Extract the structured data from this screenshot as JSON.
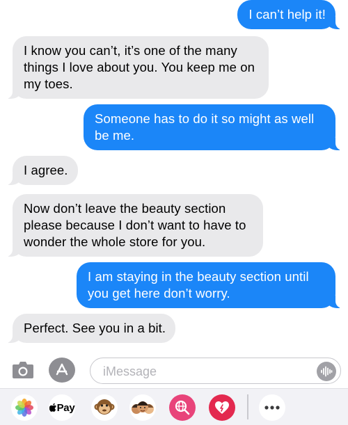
{
  "messages": [
    {
      "from": "me",
      "text": "I can’t help it!"
    },
    {
      "from": "them",
      "text": "I know you can’t, it’s one of the many\nthings I love about you. You keep me on\nmy toes."
    },
    {
      "from": "me",
      "text": "Someone has to do it so might as well\nbe me."
    },
    {
      "from": "them",
      "text": "I agree."
    },
    {
      "from": "them",
      "text": "Now don’t leave the beauty section\nplease because I don’t want to have to\nwonder the whole store for you."
    },
    {
      "from": "me",
      "text": "I am staying in the beauty section until\nyou get here don’t worry."
    },
    {
      "from": "them",
      "text": "Perfect. See you in a bit."
    }
  ],
  "composer": {
    "placeholder": "iMessage",
    "camera_icon": "camera-icon",
    "apps_icon": "app-store-icon",
    "voice_icon": "waveform-icon"
  },
  "app_drawer": {
    "apps": [
      {
        "name": "Photos",
        "icon": "photos-icon"
      },
      {
        "name": "Apple Pay",
        "label": "Pay",
        "icon": "apple-pay-icon"
      },
      {
        "name": "Memoji stickers",
        "icon": "monkey-memoji-icon"
      },
      {
        "name": "Memoji",
        "icon": "memoji-group-icon"
      },
      {
        "name": "Image search",
        "icon": "globe-search-icon"
      },
      {
        "name": "Digital Touch",
        "icon": "heart-touch-icon"
      },
      {
        "name": "More",
        "icon": "ellipsis-icon"
      }
    ]
  },
  "colors": {
    "sent_bubble": "#1b86f8",
    "received_bubble": "#e9e9eb",
    "sent_text": "#ffffff",
    "received_text": "#000000",
    "placeholder": "#b3b3b8"
  }
}
